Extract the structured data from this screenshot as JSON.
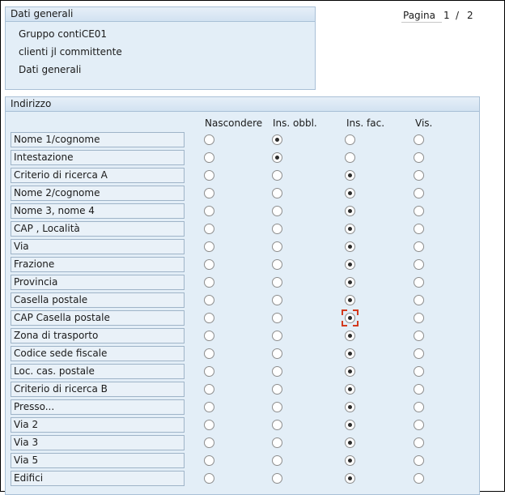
{
  "general": {
    "title": "Dati generali",
    "lines": [
      "Gruppo contiCE01",
      "clienti jl committente",
      "Dati generali"
    ]
  },
  "pager": {
    "label": "Pagina",
    "current": "1",
    "separator": "/",
    "total": "2"
  },
  "address": {
    "title": "Indirizzo",
    "columns": [
      "Nascondere",
      "Ins. obbl.",
      "Ins. fac.",
      "Vis."
    ],
    "rows": [
      {
        "label": "Nome 1/cognome",
        "selected": 1
      },
      {
        "label": "Intestazione",
        "selected": 1
      },
      {
        "label": "Criterio di ricerca A",
        "selected": 2
      },
      {
        "label": "Nome 2/cognome",
        "selected": 2
      },
      {
        "label": "Nome 3, nome 4",
        "selected": 2
      },
      {
        "label": "CAP , Località",
        "selected": 2
      },
      {
        "label": "Via",
        "selected": 2
      },
      {
        "label": "Frazione",
        "selected": 2
      },
      {
        "label": "Provincia",
        "selected": 2
      },
      {
        "label": "Casella postale",
        "selected": 2
      },
      {
        "label": "CAP Casella postale",
        "selected": 2,
        "focused": true
      },
      {
        "label": "Zona di trasporto",
        "selected": 2
      },
      {
        "label": "Codice sede fiscale",
        "selected": 2
      },
      {
        "label": "Loc. cas. postale",
        "selected": 2
      },
      {
        "label": "Criterio di ricerca B",
        "selected": 2
      },
      {
        "label": "Presso...",
        "selected": 2
      },
      {
        "label": "Via 2",
        "selected": 2
      },
      {
        "label": "Via 3",
        "selected": 2
      },
      {
        "label": "Via 5",
        "selected": 2
      },
      {
        "label": "Edifici",
        "selected": 2
      }
    ]
  }
}
